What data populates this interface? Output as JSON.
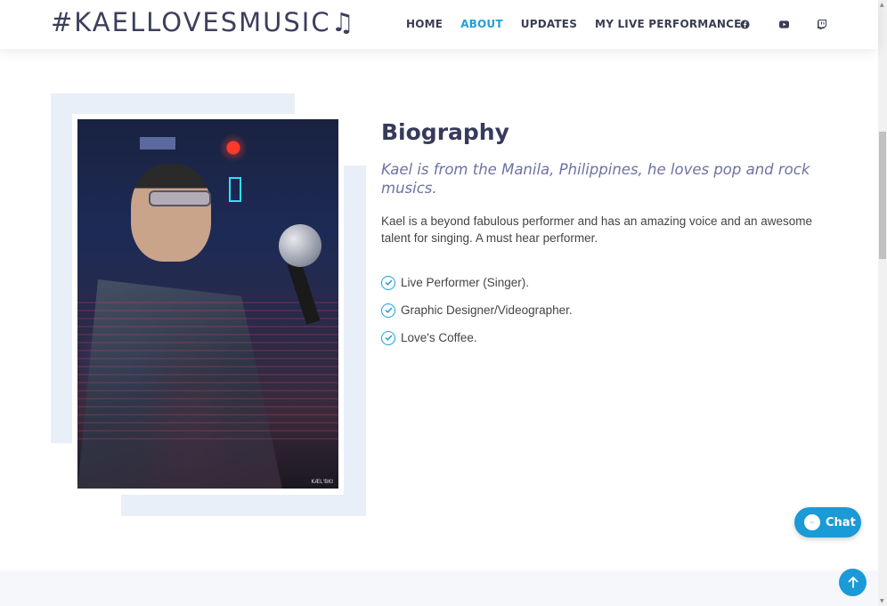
{
  "brand": {
    "logo_text": "#KAELLOVESMUSIC♫"
  },
  "nav": {
    "items": [
      {
        "label": "HOME"
      },
      {
        "label": "ABOUT"
      },
      {
        "label": "UPDATES"
      },
      {
        "label": "MY LIVE PERFORMANCE"
      }
    ],
    "active": "ABOUT"
  },
  "social": {
    "icons": [
      "facebook-icon",
      "youtube-icon",
      "twitch-icon"
    ]
  },
  "about": {
    "title": "Biography",
    "lead": "Kael is from the Manila, Philippines, he loves pop and rock musics.",
    "text": "Kael is a beyond fabulous performer and has an amazing voice and an awesome talent for singing. A must hear performer.",
    "list": [
      {
        "text": "Live Performer (Singer)."
      },
      {
        "text": "Graphic Designer/Videographer."
      },
      {
        "text": "Love's Coffee."
      }
    ],
    "photo_watermark": "KÆL'BKI"
  },
  "chat": {
    "label": "Chat"
  },
  "colors": {
    "accent": "#1fa0d8",
    "heading": "#373a5a",
    "lead": "#6e72a3",
    "deco": "#e9eff9"
  }
}
